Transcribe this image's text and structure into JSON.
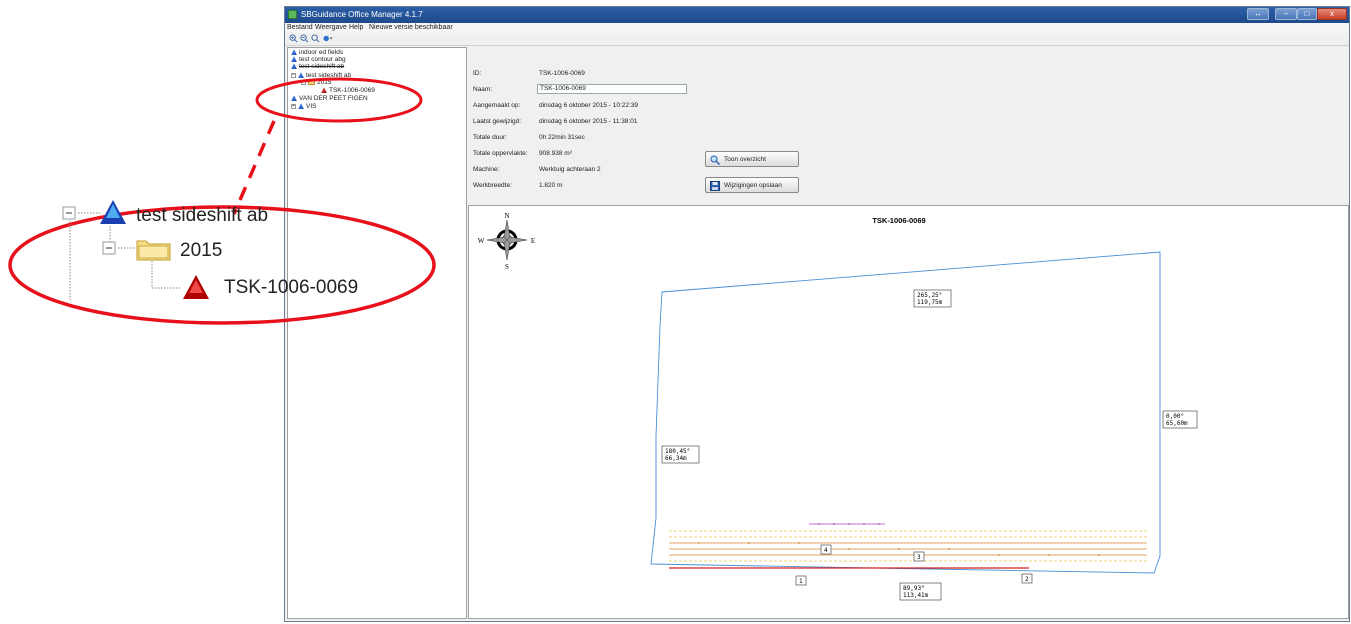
{
  "window": {
    "title": "SBGuidance Office Manager 4.1.7",
    "buttons": {
      "restore": "↔",
      "minimize": "–",
      "maximize": "□",
      "close": "x"
    }
  },
  "menu": [
    "Bestand",
    "Weergave",
    "Help",
    "Nieuwe versie beschikbaar"
  ],
  "toolbar": {
    "icons": [
      "zoom-in-icon",
      "zoom-out-icon",
      "zoom-fit-icon",
      "layer-icon"
    ]
  },
  "tree": {
    "items": [
      {
        "label": "indoor ed fields",
        "icon": "field-icon"
      },
      {
        "label": "test contour abg",
        "icon": "field-icon"
      },
      {
        "label": "test sideshift ab",
        "icon": "field-icon"
      },
      {
        "label": "2015",
        "icon": "folder-icon"
      },
      {
        "label": "TSK-1006-0069",
        "icon": "task-icon"
      },
      {
        "label": "VAN DER PEET FIGEN",
        "icon": "field-icon"
      },
      {
        "label": "VIS",
        "icon": "field-icon"
      }
    ]
  },
  "details": {
    "id_label": "ID:",
    "id_value": "TSK-1006-0069",
    "name_label": "Naam:",
    "name_value": "TSK-1006-0069",
    "created_label": "Aangemaakt op:",
    "created_value": "dinsdag 6 oktober 2015 - 10:22:39",
    "changed_label": "Laatst gewijzigd:",
    "changed_value": "dinsdag 6 oktober 2015 - 11:38:01",
    "duration_label": "Totale duur:",
    "duration_value": "0h 22min 31sec",
    "area_label": "Totale oppervlakte:",
    "area_value": "908.938 m²",
    "machine_label": "Machine:",
    "machine_value": "Werktuig achteraan 2",
    "width_label": "Werkbreedte:",
    "width_value": "1.820 m",
    "show_overview_button": "Toon overzicht",
    "save_changes_button": "Wijzigingen opslaan"
  },
  "map": {
    "title": "TSK-1006-0069",
    "compass": {
      "n": "N",
      "e": "E",
      "s": "S",
      "w": "W"
    },
    "edges": [
      {
        "angle": "265,25°",
        "length": "119,75m"
      },
      {
        "angle": "0,00°",
        "length": "65,60m"
      },
      {
        "angle": "180,45°",
        "length": "66,34m"
      },
      {
        "angle": "89,93°",
        "length": "113,41m"
      }
    ],
    "markers": [
      "1",
      "2",
      "3",
      "4"
    ],
    "colors": {
      "boundary": "#4a8fd8",
      "track_yellow": "#e8c94a",
      "track_orange": "#d6822a",
      "track_red": "#d02020",
      "track_purple": "#b040c0"
    }
  },
  "callout": {
    "items": [
      {
        "label": "test sideshift ab"
      },
      {
        "label": "2015"
      },
      {
        "label": "TSK-1006-0069"
      }
    ],
    "highlight_color": "#e8101a"
  }
}
